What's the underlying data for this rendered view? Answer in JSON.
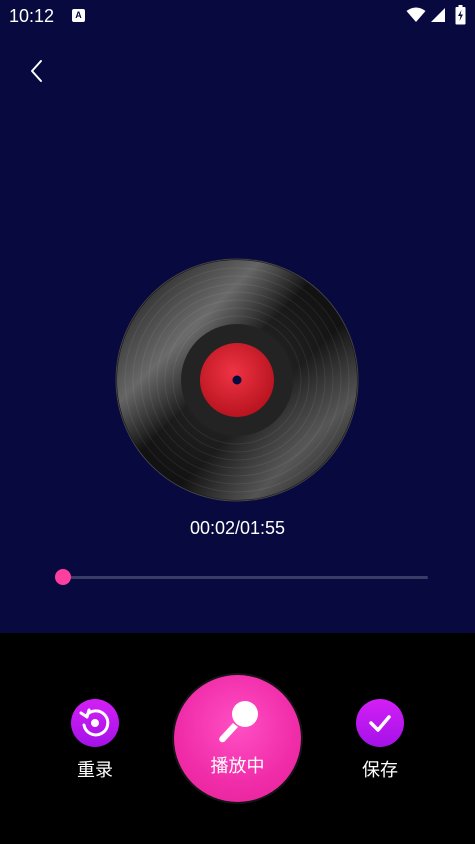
{
  "status_bar": {
    "time": "10:12",
    "notification_letter": "A",
    "icons": [
      "wifi-icon",
      "signal-icon",
      "battery-icon"
    ]
  },
  "header": {
    "back_icon": "chevron-left-icon"
  },
  "player": {
    "current_time": "00:02",
    "total_time": "01:55",
    "time_display": "00:02/01:55",
    "progress": 0.02
  },
  "actions": {
    "rerecord_label": "重录",
    "play_label": "播放中",
    "save_label": "保存"
  },
  "colors": {
    "background": "#08093f",
    "accent_pink": "#ff3fa0",
    "accent_purple": "#c118ef",
    "bottom_bar": "#000000"
  }
}
